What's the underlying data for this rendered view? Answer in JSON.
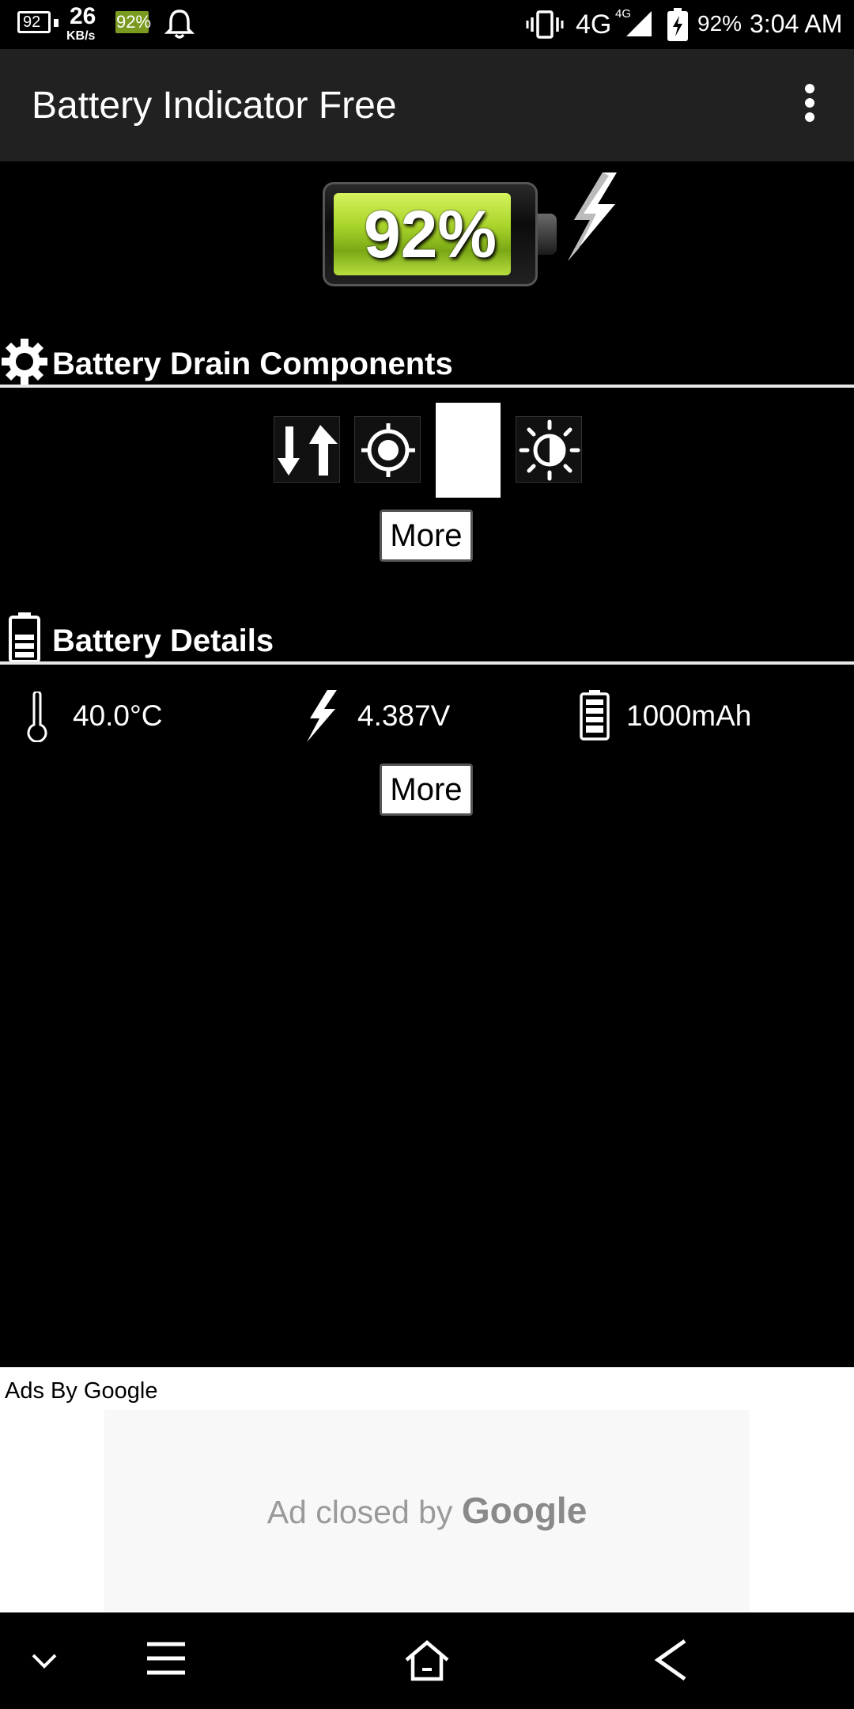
{
  "status_bar": {
    "battery_box_text": "92",
    "speed_value": "26",
    "speed_unit": "KB/s",
    "battery_icon_text": "92%",
    "network_label": "4G",
    "network_superscript": "4G",
    "battery_percent": "92%",
    "time": "3:04 AM"
  },
  "app_bar": {
    "title": "Battery Indicator Free"
  },
  "battery": {
    "percent_text": "92%",
    "level": 0.92,
    "fill_color": "#a9d42a",
    "charging_icon": "lightning-bolt-icon"
  },
  "drain_section": {
    "title": "Battery Drain Components",
    "icon": "gear-icon",
    "components": [
      "data-transfer-icon",
      "gps-icon",
      "blank-tile",
      "auto-brightness-icon"
    ],
    "more_label": "More"
  },
  "details_section": {
    "title": "Battery Details",
    "icon": "battery-icon",
    "temperature": "40.0°C",
    "voltage": "4.387V",
    "capacity": "1000mAh",
    "more_label": "More"
  },
  "ads": {
    "label": "Ads By Google",
    "closed_prefix": "Ad closed by ",
    "closed_brand": "Google"
  },
  "nav_bar": {
    "items": [
      "collapse-icon",
      "menu-icon",
      "home-icon",
      "back-icon"
    ]
  }
}
